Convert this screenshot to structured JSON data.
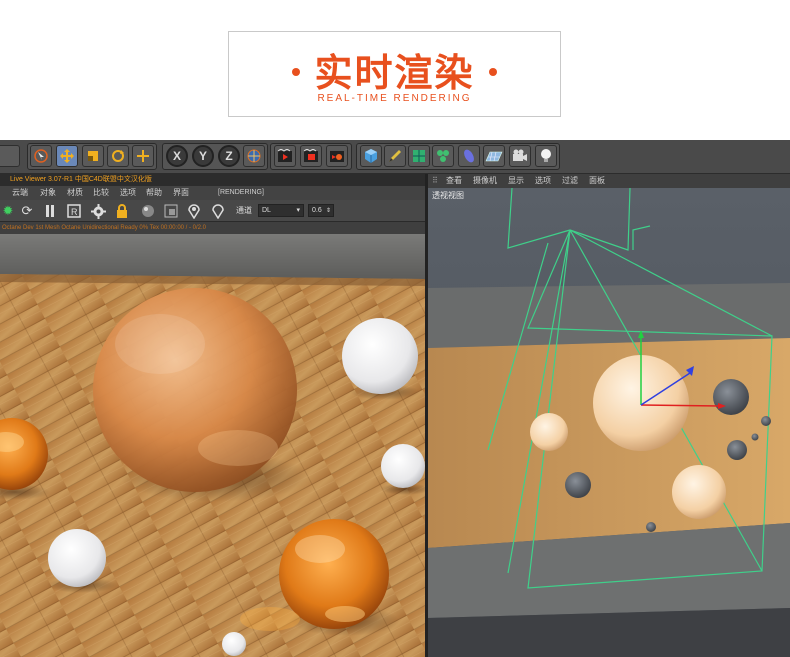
{
  "banner": {
    "title": "实时渲染",
    "subtitle": "REAL-TIME RENDERING"
  },
  "toolbar": {
    "icons": [
      "live-select-icon",
      "move-icon",
      "scale-icon",
      "rotate-icon",
      "add-icon",
      "x-axis-icon",
      "y-axis-icon",
      "z-axis-icon",
      "world-coords-icon",
      "render-view-icon",
      "render-picture-viewer-icon",
      "render-settings-icon",
      "cube-icon",
      "pen-icon",
      "subdivision-icon",
      "cloner-icon",
      "deformer-icon",
      "floor-icon",
      "camera-icon",
      "light-icon"
    ],
    "x_label": "X",
    "y_label": "Y",
    "z_label": "Z"
  },
  "live_viewer": {
    "title": "Live Viewer 3.07-R1  中国C4D联盟中文汉化版",
    "menu": [
      "云端",
      "对象",
      "材质",
      "比较",
      "选项",
      "帮助",
      "界面"
    ],
    "state": "[RENDERING]",
    "channel_label": "通道",
    "channel_value": "DL",
    "value_field": "0.6",
    "status": "Octane Dev 1st  Mesh Octane  Unidirectional  Ready  0%  Tex  00:00:00 / -  0/2.0"
  },
  "viewport": {
    "menu": [
      "查看",
      "摄像机",
      "显示",
      "选项",
      "过滤",
      "面板"
    ],
    "label": "透视视图"
  },
  "colors": {
    "accent": "#e8501e",
    "gizmo_green": "#3fd08a",
    "floor_wood": "#c8904a"
  }
}
